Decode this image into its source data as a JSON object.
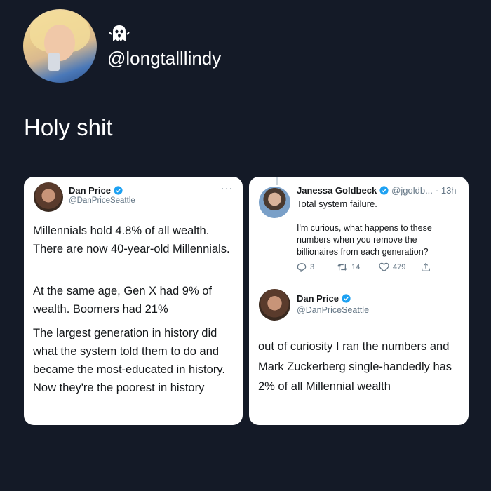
{
  "post": {
    "handle": "@longtalllindy",
    "text": "Holy shit"
  },
  "left_tweet": {
    "name": "Dan Price",
    "handle": "@DanPriceSeattle",
    "more": "···",
    "paragraphs": [
      "Millennials hold 4.8% of all wealth. There are now 40-year-old Millennials.",
      "At the same age, Gen X had 9% of wealth. Boomers had 21%",
      "The largest generation in history did what the system told them to do and became the most-educated in history. Now they're the poorest in history"
    ]
  },
  "right_reply": {
    "name": "Janessa Goldbeck",
    "handle": "@jgoldb...",
    "time": "· 13h",
    "lead": "Total system failure.",
    "text": "I'm curious, what happens to these numbers when you remove the billionaires from each generation?",
    "replies": "3",
    "retweets": "14",
    "likes": "479"
  },
  "right_tweet": {
    "name": "Dan Price",
    "handle": "@DanPriceSeattle",
    "text": "out of curiosity I ran the numbers and Mark Zuckerberg single-handedly has 2% of all Millennial wealth"
  },
  "colors": {
    "background": "#141a27",
    "verified": "#1da1f2",
    "text": "#14171a",
    "muted": "#657786"
  }
}
